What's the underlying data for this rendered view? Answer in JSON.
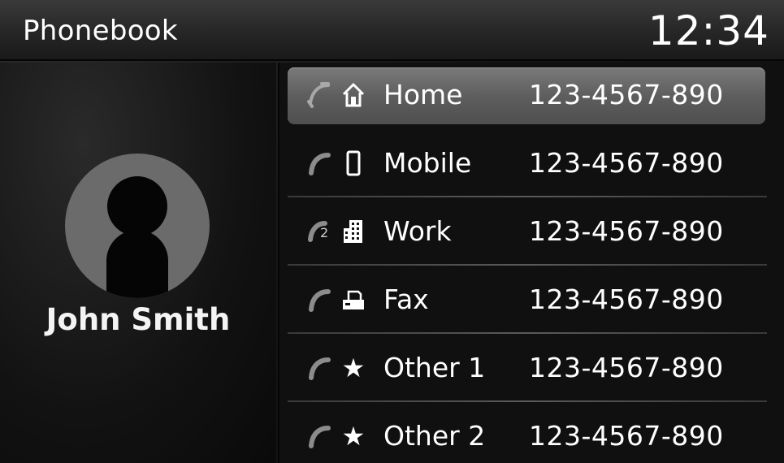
{
  "header": {
    "title": "Phonebook",
    "clock": "12:34"
  },
  "contact": {
    "name": "John Smith",
    "avatar_icon": "person-silhouette-icon"
  },
  "numbers": [
    {
      "label": "Home",
      "number": "123-4567-890",
      "icon": "house-icon",
      "selected": true
    },
    {
      "label": "Mobile",
      "number": "123-4567-890",
      "icon": "mobile-phone-icon",
      "selected": false
    },
    {
      "label": "Work",
      "number": "123-4567-890",
      "icon": "office-building-icon",
      "selected": false,
      "line_badge": "2"
    },
    {
      "label": "Fax",
      "number": "123-4567-890",
      "icon": "fax-icon",
      "selected": false
    },
    {
      "label": "Other 1",
      "number": "123-4567-890",
      "icon": "star-icon",
      "selected": false
    },
    {
      "label": "Other 2",
      "number": "123-4567-890",
      "icon": "star-icon",
      "selected": false
    }
  ],
  "colors": {
    "selected_row": "#5e5e5e",
    "avatar_bg": "#6b6b6b",
    "text": "#ffffff"
  }
}
